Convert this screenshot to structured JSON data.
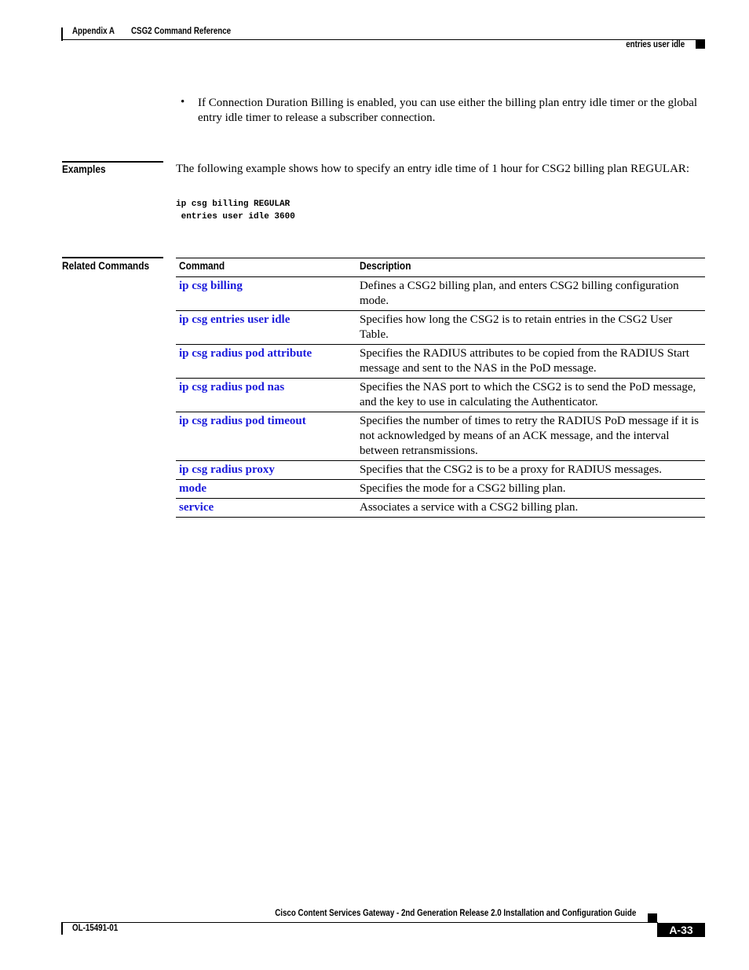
{
  "header": {
    "appendix": "Appendix A",
    "chapter": "CSG2 Command Reference",
    "section": "entries user idle"
  },
  "usage_note": {
    "bullet": "•",
    "text": "If Connection Duration Billing is enabled, you can use either the billing plan entry idle timer or the global entry idle timer to release a subscriber connection."
  },
  "examples": {
    "label": "Examples",
    "text": "The following example shows how to specify an entry idle time of 1 hour for CSG2 billing plan REGULAR:",
    "code": "ip csg billing REGULAR\n entries user idle 3600"
  },
  "related": {
    "label": "Related Commands",
    "headers": {
      "command": "Command",
      "description": "Description"
    },
    "rows": [
      {
        "command": "ip csg billing",
        "description": "Defines a CSG2 billing plan, and enters CSG2 billing configuration mode."
      },
      {
        "command": "ip csg entries user idle",
        "description": "Specifies how long the CSG2 is to retain entries in the CSG2 User Table."
      },
      {
        "command": "ip csg radius pod attribute",
        "description": "Specifies the RADIUS attributes to be copied from the RADIUS Start message and sent to the NAS in the PoD message."
      },
      {
        "command": "ip csg radius pod nas",
        "description": "Specifies the NAS port to which the CSG2 is to send the PoD message, and the key to use in calculating the Authenticator."
      },
      {
        "command": "ip csg radius pod timeout",
        "description": "Specifies the number of times to retry the RADIUS PoD message if it is not acknowledged by means of an ACK message, and the interval between retransmissions."
      },
      {
        "command": "ip csg radius proxy",
        "description": "Specifies that the CSG2 is to be a proxy for RADIUS messages."
      },
      {
        "command": "mode",
        "description": "Specifies the mode for a CSG2 billing plan."
      },
      {
        "command": "service",
        "description": "Associates a service with a CSG2 billing plan."
      }
    ]
  },
  "footer": {
    "guide_title": "Cisco Content Services Gateway - 2nd Generation Release 2.0 Installation and Configuration Guide",
    "doc_number": "OL-15491-01",
    "page_number": "A-33"
  },
  "colors": {
    "link": "#1a1adb"
  }
}
